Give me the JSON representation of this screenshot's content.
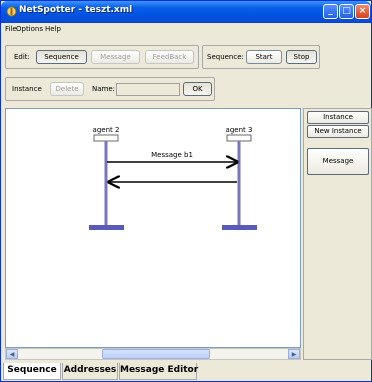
{
  "window": {
    "title": "NetSpotter - teszt.xml"
  },
  "menu": [
    "File",
    "Options",
    "Help"
  ],
  "edit_toolbar": {
    "label": "Edit:",
    "buttons": [
      "Sequence",
      "Message",
      "FeedBack"
    ]
  },
  "sequence_toolbar": {
    "label": "Sequence:",
    "start": "Start",
    "stop": "Stop"
  },
  "instance_toolbar": {
    "instance_label": "Instance",
    "delete": "Delete",
    "name_label": "Name:",
    "name_value": "",
    "ok": "OK"
  },
  "diagram": {
    "agents": [
      "agent 2",
      "agent 3"
    ],
    "message_label": "Message b1"
  },
  "palette": {
    "instance": "Instance",
    "new_instance": "New Instance",
    "message": "Message"
  },
  "tabs": [
    "Sequence",
    "Addresses",
    "Message Editor"
  ],
  "colors": {
    "lifeline": "#7777c0",
    "bar": "#5a5ab8",
    "titlebar": "#0054e3"
  }
}
